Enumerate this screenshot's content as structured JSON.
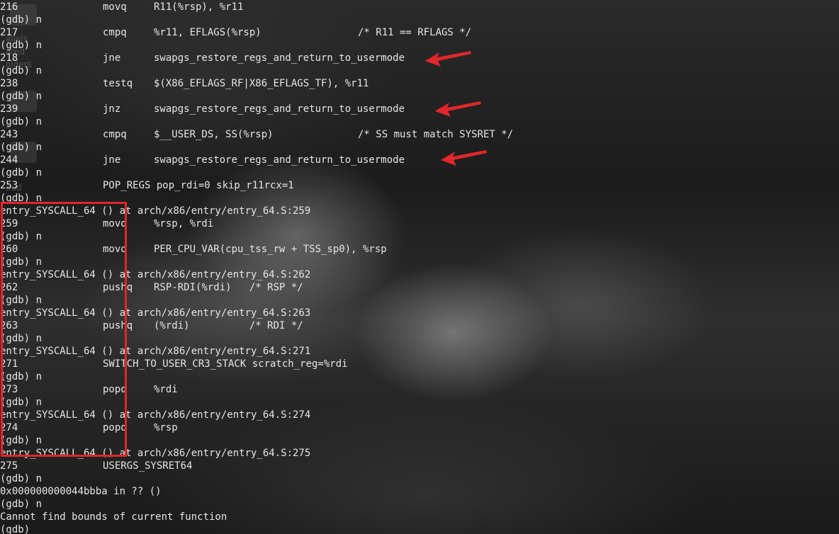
{
  "desktop": {
    "icon_labels": [
      "allels",
      "ared",
      "olders",
      "s",
      "oud"
    ]
  },
  "colors": {
    "terminal_text": "#e6e6e6",
    "annotation_red": "#e3262b"
  },
  "terminal": {
    "lines": [
      {
        "num": "216",
        "instr": "movq",
        "ops": "R11(%rsp), %r11",
        "comment": ""
      },
      {
        "prompt": "(gdb) n"
      },
      {
        "num": "217",
        "instr": "cmpq",
        "ops": "%r11, EFLAGS(%rsp)",
        "comment": "/* R11 == RFLAGS */"
      },
      {
        "prompt": "(gdb) n"
      },
      {
        "num": "218",
        "instr": "jne",
        "ops": "swapgs_restore_regs_and_return_to_usermode",
        "comment": ""
      },
      {
        "prompt": "(gdb) n"
      },
      {
        "num": "238",
        "instr": "testq",
        "ops": "$(X86_EFLAGS_RF|X86_EFLAGS_TF), %r11",
        "comment": ""
      },
      {
        "prompt": "(gdb) n"
      },
      {
        "num": "239",
        "instr": "jnz",
        "ops": "swapgs_restore_regs_and_return_to_usermode",
        "comment": ""
      },
      {
        "prompt": "(gdb) n"
      },
      {
        "num": "243",
        "instr": "cmpq",
        "ops": "$__USER_DS, SS(%rsp)",
        "comment": "/* SS must match SYSRET */"
      },
      {
        "prompt": "(gdb) n"
      },
      {
        "num": "244",
        "instr": "jne",
        "ops": "swapgs_restore_regs_and_return_to_usermode",
        "comment": ""
      },
      {
        "prompt": "(gdb) n"
      },
      {
        "num": "253",
        "instr": "POP_REGS pop_rdi=0 skip_r11rcx=1",
        "ops": "",
        "comment": ""
      },
      {
        "prompt": "(gdb) n"
      },
      {
        "full": "entry_SYSCALL_64 () at arch/x86/entry/entry_64.S:259"
      },
      {
        "num": "259",
        "instr": "movq",
        "ops": "%rsp, %rdi",
        "comment": ""
      },
      {
        "prompt": "(gdb) n"
      },
      {
        "num": "260",
        "instr": "movq",
        "ops": "PER_CPU_VAR(cpu_tss_rw + TSS_sp0), %rsp",
        "comment": ""
      },
      {
        "prompt": "(gdb) n"
      },
      {
        "full": "entry_SYSCALL_64 () at arch/x86/entry/entry_64.S:262"
      },
      {
        "num": "262",
        "instr": "pushq",
        "ops": "RSP-RDI(%rdi)   /* RSP */",
        "comment": ""
      },
      {
        "prompt": "(gdb) n"
      },
      {
        "full": "entry_SYSCALL_64 () at arch/x86/entry/entry_64.S:263"
      },
      {
        "num": "263",
        "instr": "pushq",
        "ops": "(%rdi)          /* RDI */",
        "comment": ""
      },
      {
        "prompt": "(gdb) n"
      },
      {
        "full": "entry_SYSCALL_64 () at arch/x86/entry/entry_64.S:271"
      },
      {
        "num": "271",
        "instr": "SWITCH_TO_USER_CR3_STACK scratch_reg=%rdi",
        "ops": "",
        "comment": ""
      },
      {
        "prompt": "(gdb) n"
      },
      {
        "num": "273",
        "instr": "popq",
        "ops": "%rdi",
        "comment": ""
      },
      {
        "prompt": "(gdb) n"
      },
      {
        "full": "entry_SYSCALL_64 () at arch/x86/entry/entry_64.S:274"
      },
      {
        "num": "274",
        "instr": "popq",
        "ops": "%rsp",
        "comment": ""
      },
      {
        "prompt": "(gdb) n"
      },
      {
        "full": "entry_SYSCALL_64 () at arch/x86/entry/entry_64.S:275"
      },
      {
        "num": "275",
        "instr": "USERGS_SYSRET64",
        "ops": "",
        "comment": ""
      },
      {
        "prompt": "(gdb) n"
      },
      {
        "full": "0x000000000044bbba in ?? ()"
      },
      {
        "prompt": "(gdb) n"
      },
      {
        "full": "Cannot find bounds of current function"
      },
      {
        "prompt": "(gdb)"
      }
    ]
  }
}
